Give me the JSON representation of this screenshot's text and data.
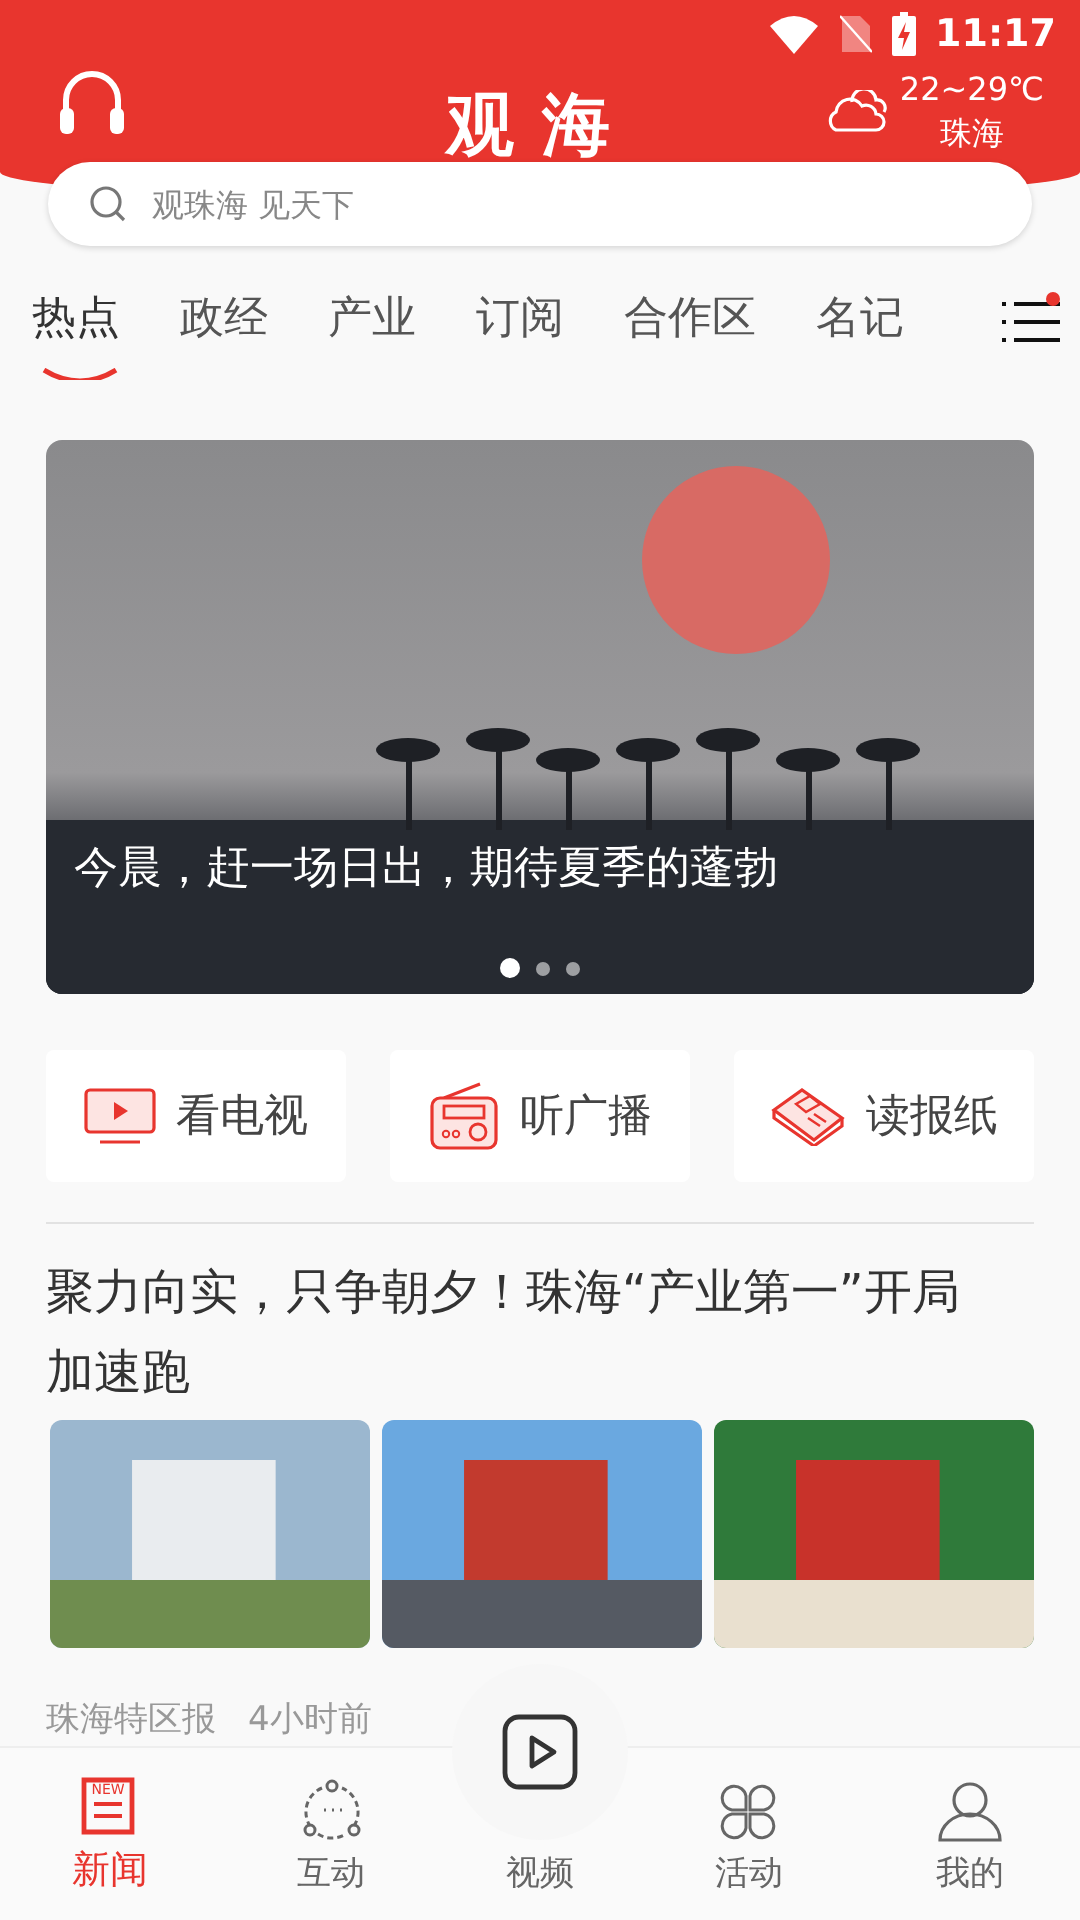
{
  "status_bar": {
    "time": "11:17"
  },
  "header": {
    "title": "观海",
    "weather": {
      "temp": "22~29℃",
      "city": "珠海"
    }
  },
  "search": {
    "placeholder": "观珠海 见天下"
  },
  "tabs": [
    {
      "label": "热点",
      "selected": true
    },
    {
      "label": "政经",
      "selected": false
    },
    {
      "label": "产业",
      "selected": false
    },
    {
      "label": "订阅",
      "selected": false
    },
    {
      "label": "合作区",
      "selected": false
    },
    {
      "label": "名记",
      "selected": false
    }
  ],
  "tabs_menu": {
    "unread": true
  },
  "banner": {
    "caption": "今晨，赶一场日出，期待夏季的蓬勃",
    "pages": [
      {
        "selected": true
      },
      {
        "selected": false
      },
      {
        "selected": false
      }
    ]
  },
  "quick_links": [
    {
      "kind": "tv",
      "label": "看电视"
    },
    {
      "kind": "radio",
      "label": "听广播"
    },
    {
      "kind": "newspaper",
      "label": "读报纸"
    }
  ],
  "article": {
    "headline": "聚力向实，只争朝夕！珠海“产业第一”开局加速跑",
    "images": [
      {
        "kind": "aerial"
      },
      {
        "kind": "stage"
      },
      {
        "kind": "crowd"
      }
    ],
    "source": "珠海特区报",
    "time": "4小时前"
  },
  "nav": [
    {
      "kind": "news",
      "label": "新闻",
      "badge": "NEW",
      "selected": true
    },
    {
      "kind": "interact",
      "label": "互动",
      "selected": false
    },
    {
      "kind": "video",
      "label": "视频",
      "selected": false
    },
    {
      "kind": "activity",
      "label": "活动",
      "selected": false
    },
    {
      "kind": "profile",
      "label": "我的",
      "selected": false
    }
  ]
}
